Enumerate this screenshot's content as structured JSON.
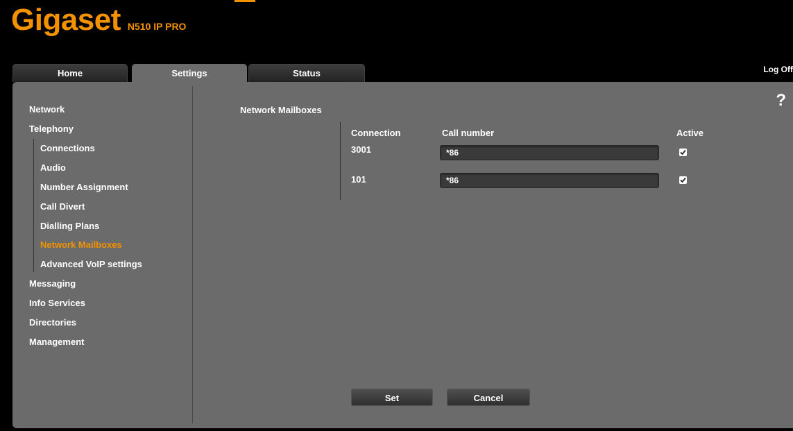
{
  "header": {
    "brand": "Gigaset",
    "model": "N510 IP PRO"
  },
  "tabs": [
    {
      "label": "Home"
    },
    {
      "label": "Settings"
    },
    {
      "label": "Status"
    }
  ],
  "logoff_label": "Log Off",
  "help_label": "?",
  "sidebar": {
    "items": [
      {
        "label": "Network"
      },
      {
        "label": "Telephony"
      },
      {
        "label": "Connections"
      },
      {
        "label": "Audio"
      },
      {
        "label": "Number Assignment"
      },
      {
        "label": "Call Divert"
      },
      {
        "label": "Dialling Plans"
      },
      {
        "label": "Network Mailboxes"
      },
      {
        "label": "Advanced VoIP settings"
      },
      {
        "label": "Messaging"
      },
      {
        "label": "Info Services"
      },
      {
        "label": "Directories"
      },
      {
        "label": "Management"
      }
    ]
  },
  "content": {
    "title": "Network Mailboxes",
    "columns": {
      "connection": "Connection",
      "call_number": "Call number",
      "active": "Active"
    },
    "rows": [
      {
        "connection": "3001",
        "call_number": "*86",
        "active": true
      },
      {
        "connection": "101",
        "call_number": "*86",
        "active": true
      }
    ]
  },
  "buttons": {
    "set": "Set",
    "cancel": "Cancel"
  },
  "colors": {
    "accent": "#f39200",
    "panel": "#6b6b6b",
    "background": "#000000"
  }
}
